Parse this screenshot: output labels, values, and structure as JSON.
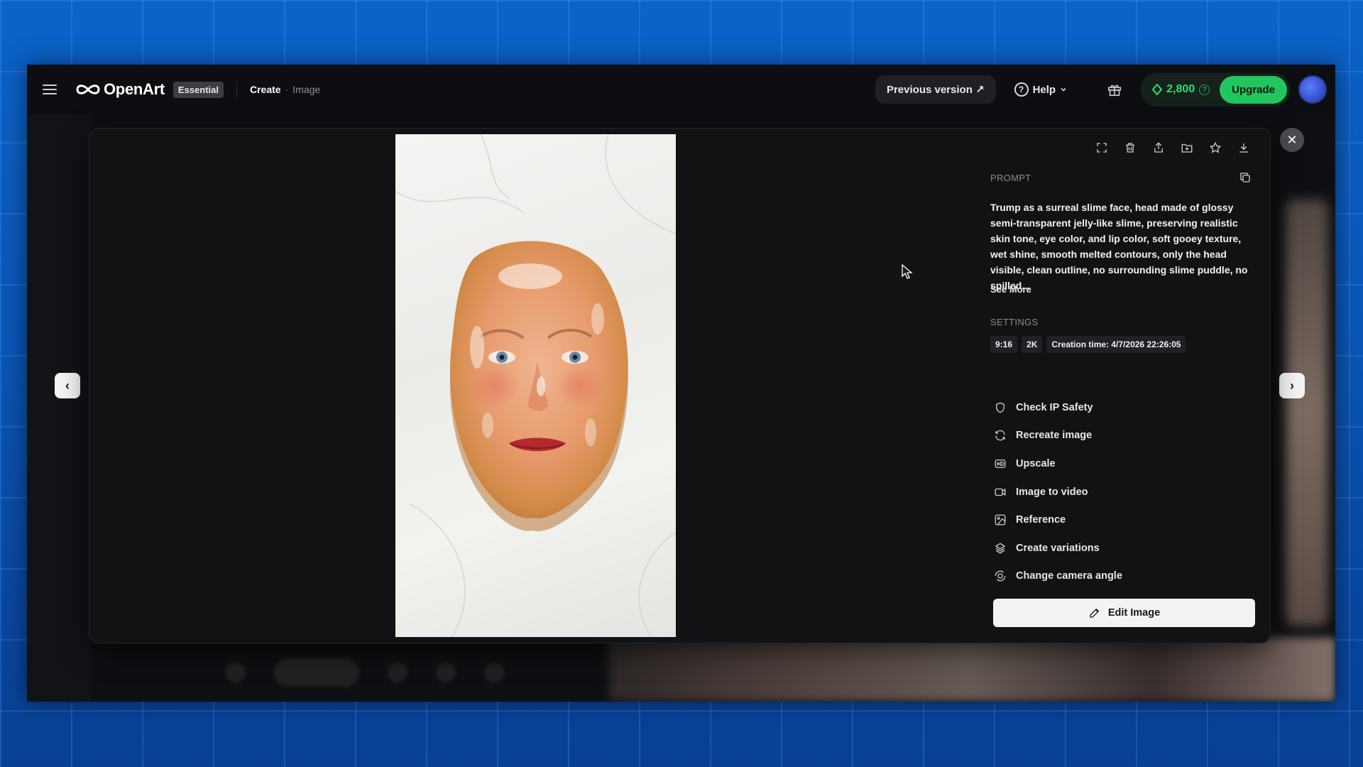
{
  "header": {
    "brand": "OpenArt",
    "plan": "Essential",
    "breadcrumb_create": "Create",
    "breadcrumb_sep": "·",
    "breadcrumb_image": "Image",
    "previous_version": "Previous version ↗",
    "help": "Help",
    "credits": "2,800",
    "upgrade": "Upgrade"
  },
  "viewer": {
    "prev_arrow": "‹",
    "next_arrow": "›",
    "close": "✕"
  },
  "panel": {
    "prompt_label": "PROMPT",
    "prompt_text": "Trump as a surreal slime face, head made of glossy semi-transparent jelly-like slime, preserving realistic skin tone, eye color, and lip color, soft gooey texture, wet shine, smooth melted contours, only the head visible, clean outline, no surrounding slime puddle, no spilled...",
    "see_more": "See More",
    "settings_label": "SETTINGS",
    "settings": [
      "9:16",
      "2K",
      "Creation time: 4/7/2026 22:26:05"
    ],
    "actions": [
      {
        "label": "Check IP Safety",
        "icon": "shield-icon"
      },
      {
        "label": "Recreate image",
        "icon": "refresh-icon"
      },
      {
        "label": "Upscale",
        "icon": "hd-icon"
      },
      {
        "label": "Image to video",
        "icon": "video-icon"
      },
      {
        "label": "Reference",
        "icon": "reference-icon"
      },
      {
        "label": "Create variations",
        "icon": "variations-icon"
      },
      {
        "label": "Change camera angle",
        "icon": "camera-angle-icon"
      }
    ],
    "edit_button": "Edit Image"
  },
  "colors": {
    "accent_green": "#22c55e",
    "credits_green": "#2fdc72",
    "modal_bg": "#111214",
    "page_bg": "#0b63c9"
  }
}
